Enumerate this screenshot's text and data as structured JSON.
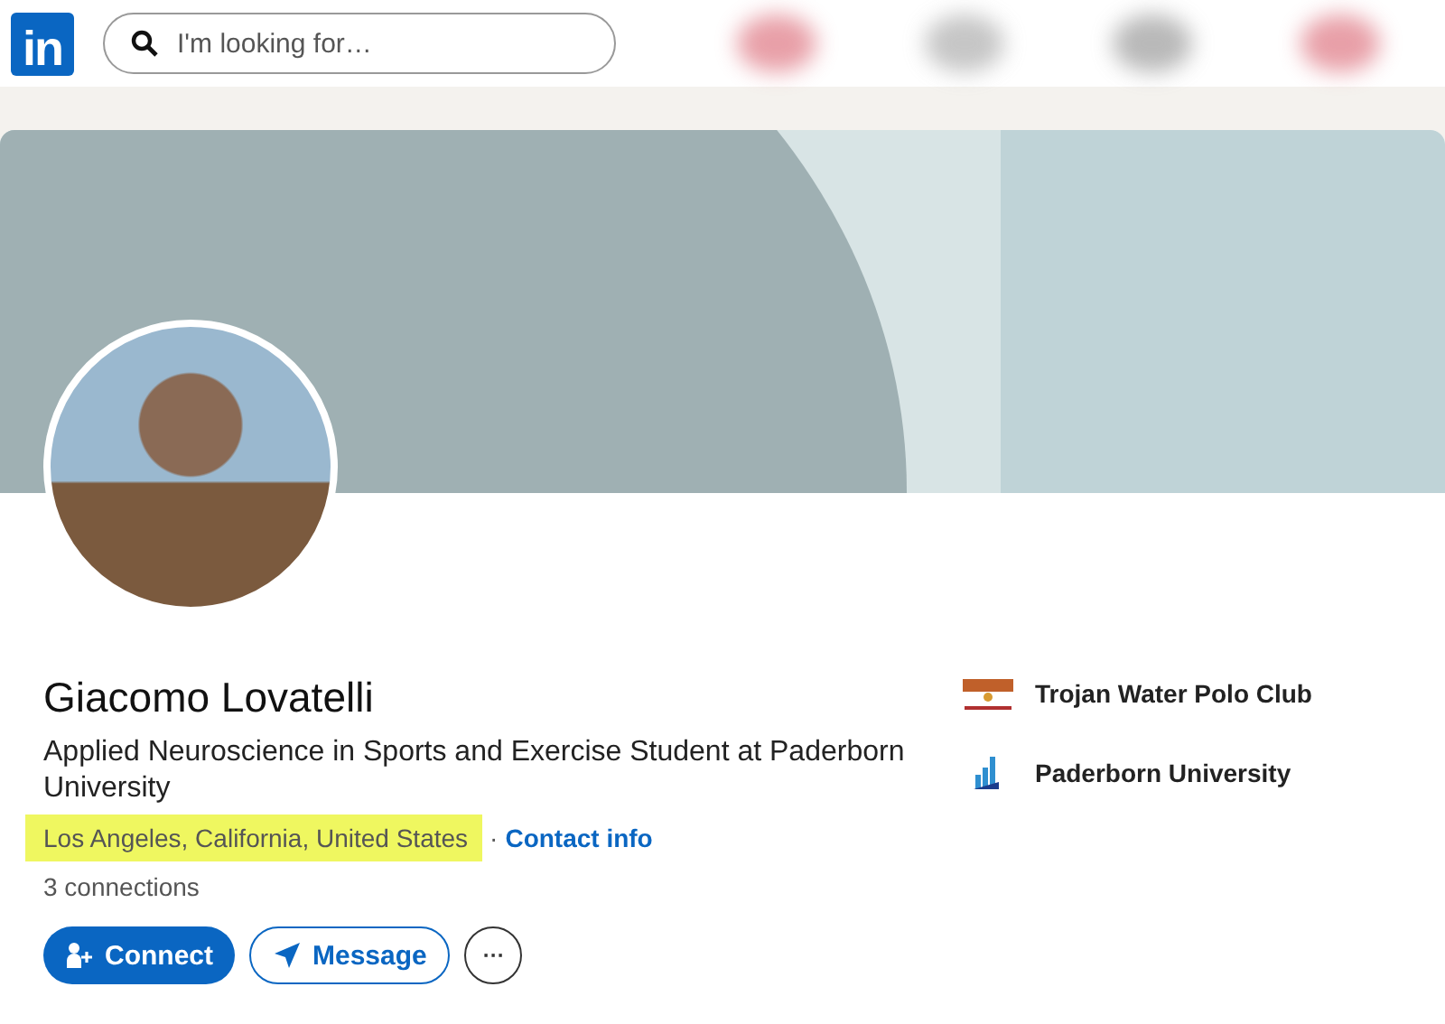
{
  "header": {
    "logo": "in",
    "search": {
      "placeholder": "I'm looking for…"
    }
  },
  "profile": {
    "name": "Giacomo Lovatelli",
    "headline": "Applied Neuroscience in Sports and Exercise Student at Paderborn University",
    "location": {
      "text": "Los Angeles, California, United States",
      "highlighted": true
    },
    "separator": "·",
    "contact_link": "Contact info",
    "connections": "3 connections",
    "buttons": [
      {
        "kind": "primary",
        "label": "Connect"
      },
      {
        "kind": "secondary",
        "label": "Message"
      },
      {
        "kind": "more",
        "label": "···"
      }
    ]
  },
  "affiliations": [
    {
      "kind": "club",
      "name": "Trojan Water Polo Club"
    },
    {
      "kind": "university",
      "name": "Paderborn University"
    }
  ]
}
